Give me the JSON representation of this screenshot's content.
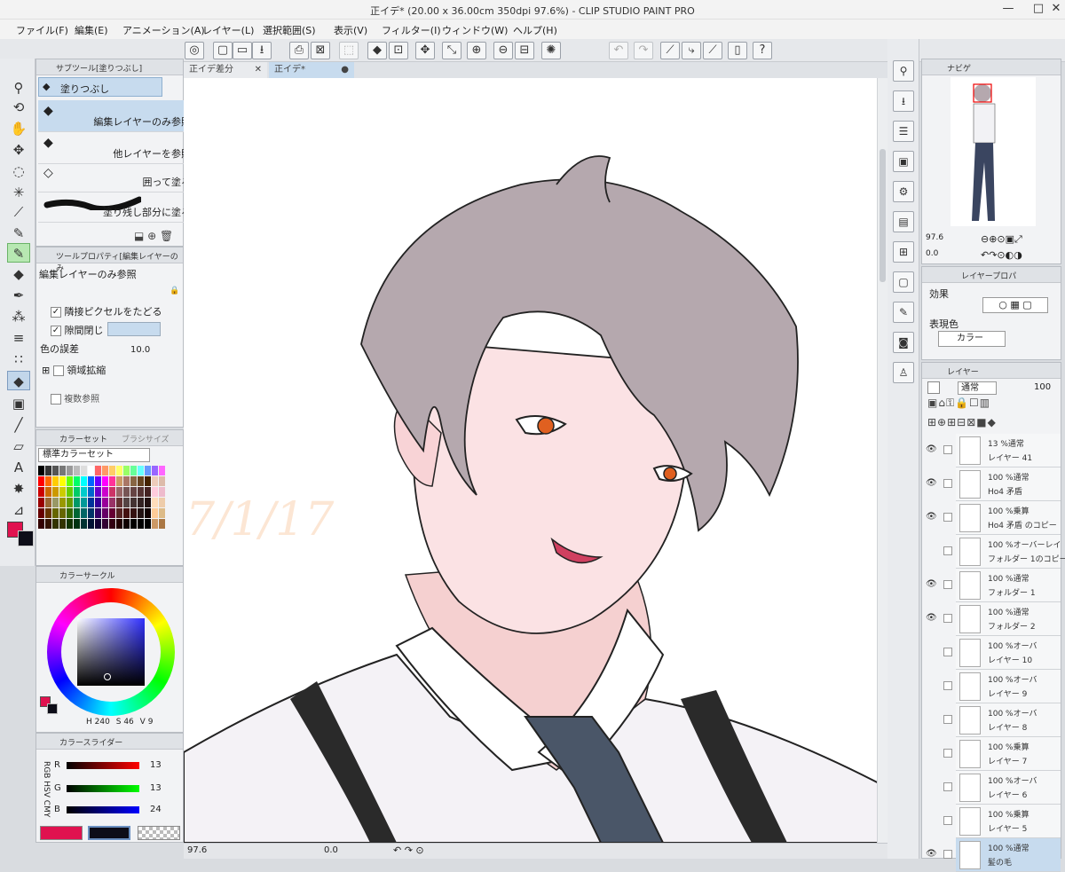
{
  "window": {
    "title": "正イデ* (20.00 x 36.00cm 350dpi 97.6%)  - CLIP STUDIO PAINT PRO",
    "controls": [
      "—",
      "□",
      "✕"
    ]
  },
  "menu": [
    "ファイル(F)",
    "編集(E)",
    "アニメーション(A)",
    "レイヤー(L)",
    "選択範囲(S)",
    "表示(V)",
    "フィルター(I)",
    "ウィンドウ(W)",
    "ヘルプ(H)"
  ],
  "subtool_panel": {
    "tab": "サブツール[塗りつぶし]",
    "header_item": "塗りつぶし",
    "items": [
      "編集レイヤーのみ参照",
      "他レイヤーを参照",
      "囲って塗る",
      "塗り残し部分に塗る"
    ]
  },
  "tool_property": {
    "tab": "ツールプロパティ[編集レイヤーのみ",
    "current": "編集レイヤーのみ参照",
    "options": {
      "adjacent": "隣接ピクセルをたどる",
      "close_gap": "隙間閉じ",
      "color_margin_label": "色の誤差",
      "color_margin_value": "10.0",
      "area_scaling": "領域拡縮",
      "multi_ref": "複数参照"
    }
  },
  "color_set": {
    "tab_active": "カラーセット",
    "tab_other": "ブラシサイズ",
    "set_name": "標準カラーセット"
  },
  "color_wheel": {
    "tab": "カラーサークル",
    "h": "240",
    "s": "46",
    "v": "9",
    "h_label": "H",
    "s_label": "S",
    "v_label": "V"
  },
  "color_slider": {
    "tab": "カラースライダー",
    "mode_labels": [
      "RGB",
      "HSV",
      "CMY"
    ],
    "r": "13",
    "g": "13",
    "b": "24",
    "r_label": "R",
    "g_label": "G",
    "b_label": "B"
  },
  "colors": {
    "main": "#e0124f",
    "sub": "#0d0d18",
    "accent_green": "#b7e8b2",
    "selection_blue": "#c7dbee"
  },
  "canvas_tabs": [
    {
      "label": "正イデ差分"
    },
    {
      "label": "正イデ*"
    }
  ],
  "watermark": "7/1/17",
  "statusbar": {
    "zoom": "97.6",
    "angle": "0.0"
  },
  "navigator": {
    "tab": "ナビゲ",
    "zoom": "97.6",
    "angle": "0.0"
  },
  "layer_property": {
    "tab": "レイヤープロパ",
    "effect_label": "効果",
    "color_label": "表現色",
    "color_value": "カラー"
  },
  "layer_panel": {
    "tab": "レイヤー",
    "blend": "通常",
    "opacity": "100",
    "layers": [
      {
        "mode": "13 %通常",
        "name": "レイヤー 41",
        "visible": true
      },
      {
        "mode": "100 %通常",
        "name": "Ho4 矛盾",
        "visible": true
      },
      {
        "mode": "100 %乗算",
        "name": "Ho4 矛盾 のコピー",
        "visible": true
      },
      {
        "mode": "100 %オーバーレイ",
        "name": "フォルダー 1のコピー",
        "visible": false
      },
      {
        "mode": "100 %通常",
        "name": "フォルダー 1",
        "visible": true
      },
      {
        "mode": "100 %通常",
        "name": "フォルダー 2",
        "visible": true
      },
      {
        "mode": "100 %オーバ",
        "name": "レイヤー 10",
        "visible": false
      },
      {
        "mode": "100 %オーバ",
        "name": "レイヤー 9",
        "visible": false
      },
      {
        "mode": "100 %オーバ",
        "name": "レイヤー 8",
        "visible": false
      },
      {
        "mode": "100 %乗算",
        "name": "レイヤー 7",
        "visible": false
      },
      {
        "mode": "100 %オーバ",
        "name": "レイヤー 6",
        "visible": false
      },
      {
        "mode": "100 %乗算",
        "name": "レイヤー 5",
        "visible": false
      },
      {
        "mode": "100 %通常",
        "name": "髪の毛",
        "visible": true
      }
    ]
  }
}
